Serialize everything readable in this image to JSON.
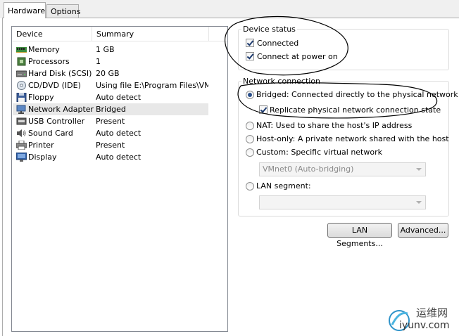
{
  "tabs": [
    {
      "label": "Hardware",
      "active": true
    },
    {
      "label": "Options",
      "active": false
    }
  ],
  "device_list": {
    "columns": [
      "Device",
      "Summary"
    ],
    "rows": [
      {
        "device": "Memory",
        "summary": "1 GB",
        "icon": "memory-icon"
      },
      {
        "device": "Processors",
        "summary": "1",
        "icon": "processor-icon"
      },
      {
        "device": "Hard Disk (SCSI)",
        "summary": "20 GB",
        "icon": "hard-disk-icon"
      },
      {
        "device": "CD/DVD (IDE)",
        "summary": "Using file E:\\Program Files\\VM...",
        "icon": "cd-dvd-icon"
      },
      {
        "device": "Floppy",
        "summary": "Auto detect",
        "icon": "floppy-icon"
      },
      {
        "device": "Network Adapter",
        "summary": "Bridged",
        "icon": "network-adapter-icon",
        "selected": true
      },
      {
        "device": "USB Controller",
        "summary": "Present",
        "icon": "usb-icon"
      },
      {
        "device": "Sound Card",
        "summary": "Auto detect",
        "icon": "sound-icon"
      },
      {
        "device": "Printer",
        "summary": "Present",
        "icon": "printer-icon"
      },
      {
        "device": "Display",
        "summary": "Auto detect",
        "icon": "display-icon"
      }
    ]
  },
  "device_status": {
    "title": "Device status",
    "connected_label": "Connected",
    "connected_checked": true,
    "connect_power_label": "Connect at power on",
    "connect_power_checked": true
  },
  "network_connection": {
    "title": "Network connection",
    "bridged_label": "Bridged: Connected directly to the physical network",
    "replicate_label": "Replicate physical network connection state",
    "replicate_checked": true,
    "nat_label": "NAT: Used to share the host's IP address",
    "hostonly_label": "Host-only: A private network shared with the host",
    "custom_label": "Custom: Specific virtual network",
    "custom_select_value": "VMnet0 (Auto-bridging)",
    "lan_label": "LAN segment:",
    "lan_select_value": "",
    "selected_option": "bridged"
  },
  "buttons": {
    "lan_segments": "LAN Segments...",
    "advanced": "Advanced..."
  },
  "watermark": {
    "line1": "运维网",
    "line2": "iyunv.com"
  },
  "colors": {
    "annotation": "#000000",
    "selected_row": "#e8e8e8",
    "radio_dot": "#2a4f8a"
  }
}
